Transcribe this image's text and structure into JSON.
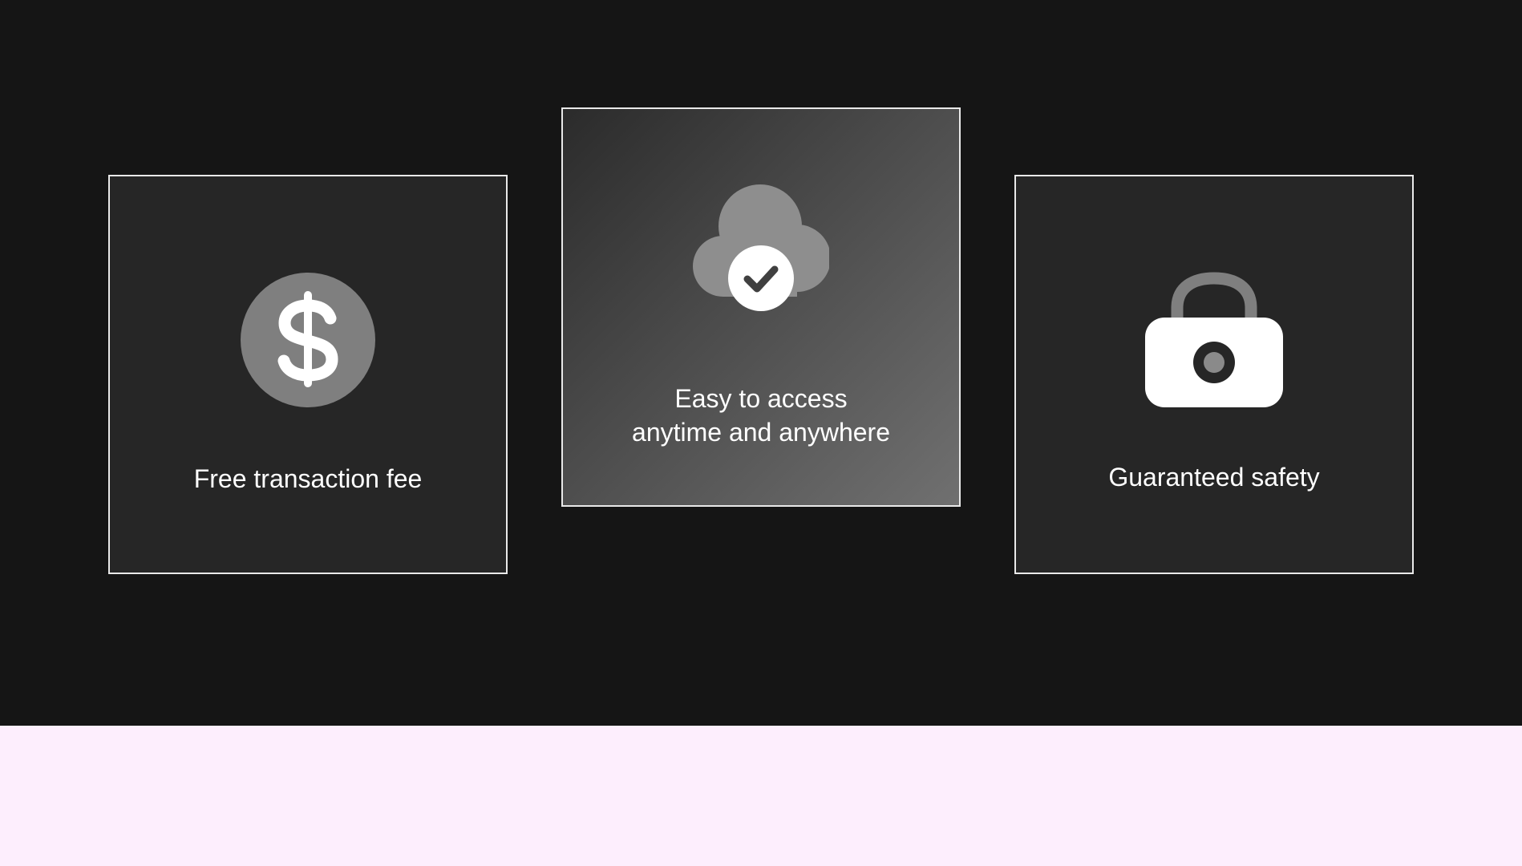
{
  "colors": {
    "background_dark": "#151515",
    "background_light": "#fdeefd",
    "card_background": "#262626",
    "card_border": "#e9e9e9",
    "icon_gray": "#7f7f7f",
    "text": "#ffffff"
  },
  "features": [
    {
      "icon": "dollar-icon",
      "label": "Free transaction fee"
    },
    {
      "icon": "cloud-check-icon",
      "label_line1": "Easy to access",
      "label_line2": "anytime and anywhere"
    },
    {
      "icon": "lock-icon",
      "label": "Guaranteed safety"
    }
  ]
}
